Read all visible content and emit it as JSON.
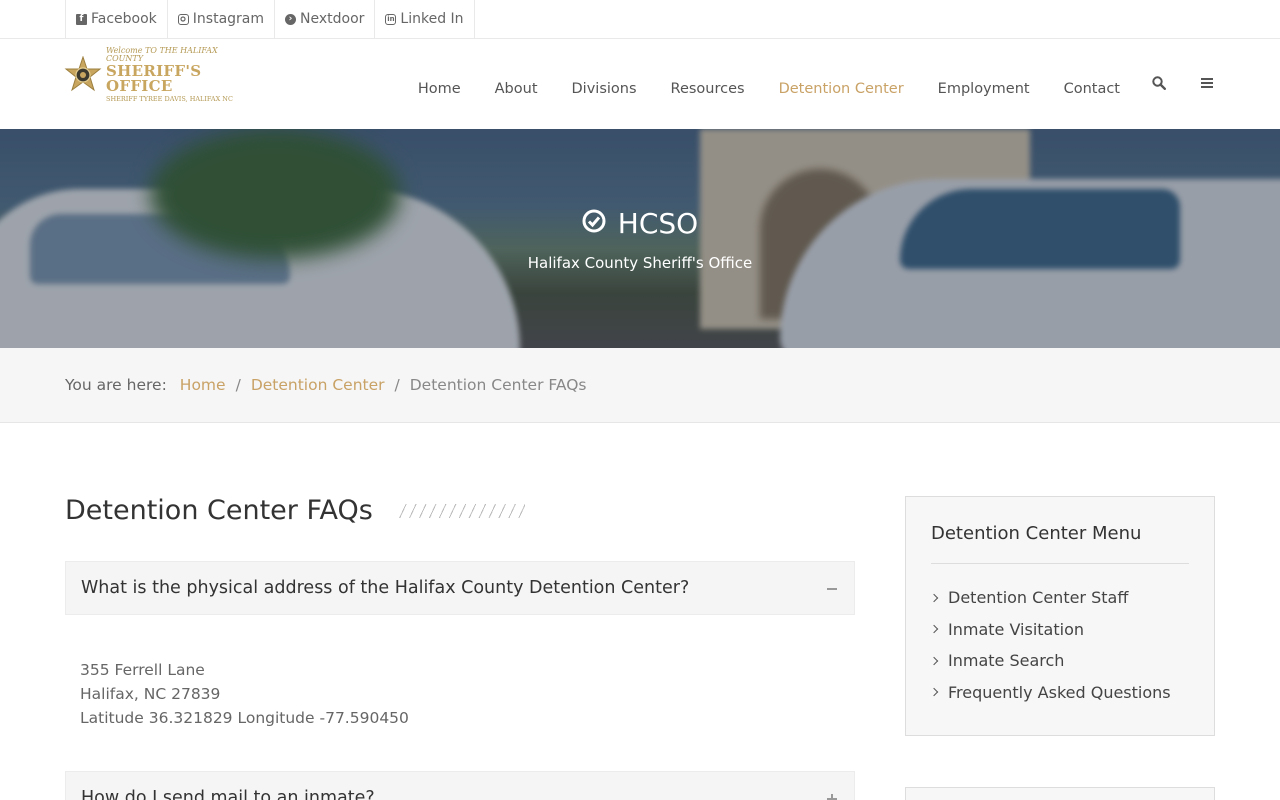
{
  "topbar": {
    "links": [
      {
        "label": "Facebook",
        "icon": "facebook-icon"
      },
      {
        "label": "Instagram",
        "icon": "instagram-icon"
      },
      {
        "label": "Nextdoor",
        "icon": "arrow-right-circle-icon"
      },
      {
        "label": "Linked In",
        "icon": "linkedin-icon"
      }
    ]
  },
  "logo": {
    "line1": "Welcome TO THE HALIFAX COUNTY",
    "line2": "SHERIFF'S OFFICE",
    "line3": "SHERIFF TYREE DAVIS, HALIFAX NC"
  },
  "nav": {
    "items": [
      "Home",
      "About",
      "Divisions",
      "Resources",
      "Detention Center",
      "Employment",
      "Contact"
    ],
    "active": "Detention Center",
    "search_icon": "search-icon",
    "menu_icon": "hamburger-icon"
  },
  "hero": {
    "title": "HCSO",
    "subtitle": "Halifax County Sheriff's Office",
    "icon": "check-circle-icon"
  },
  "breadcrumb": {
    "lead": "You are here:",
    "items": [
      "Home",
      "Detention Center"
    ],
    "current": "Detention Center FAQs"
  },
  "main": {
    "title": "Detention Center FAQs",
    "faqs": [
      {
        "question": "What is the physical address of the Halifax County Detention Center?",
        "expanded": true,
        "answer_lines": [
          "355 Ferrell Lane",
          "Halifax, NC 27839",
          "Latitude 36.321829 Longitude -77.590450"
        ]
      },
      {
        "question": "How do I send mail to an inmate?",
        "expanded": false
      }
    ]
  },
  "sidebar": {
    "title": "Detention Center Menu",
    "items": [
      "Detention Center Staff",
      "Inmate Visitation",
      "Inmate Search",
      "Frequently Asked Questions"
    ]
  },
  "colors": {
    "accent": "#c9a266",
    "text": "#555555",
    "crumb_bg": "#f6f6f6"
  }
}
